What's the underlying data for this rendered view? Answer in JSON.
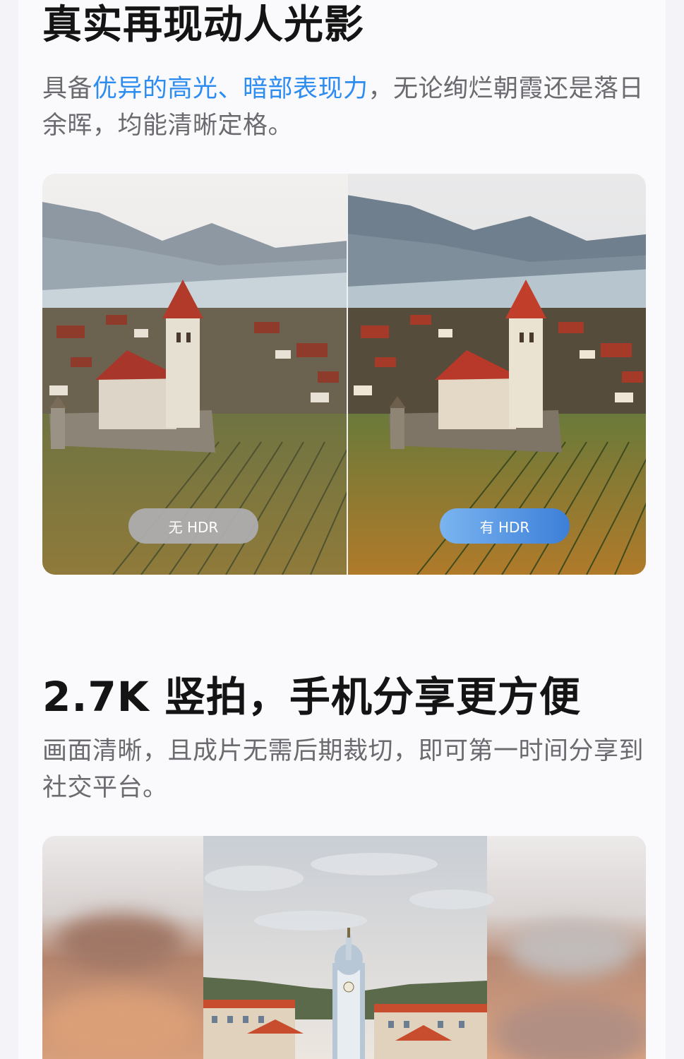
{
  "section1": {
    "title": "真实再现动人光影",
    "desc_prefix": "具备",
    "desc_highlight": "优异的高光、暗部表现力",
    "desc_suffix": "，无论绚烂朝霞还是落日余晖，均能清晰定格。"
  },
  "compare": {
    "left_label": "无 HDR",
    "right_label": "有 HDR",
    "accent": "#2d8cf0"
  },
  "section2": {
    "title": "2.7K 竖拍，手机分享更方便",
    "desc": "画面清晰，且成片无需后期裁切，即可第一时间分享到社交平台。"
  }
}
